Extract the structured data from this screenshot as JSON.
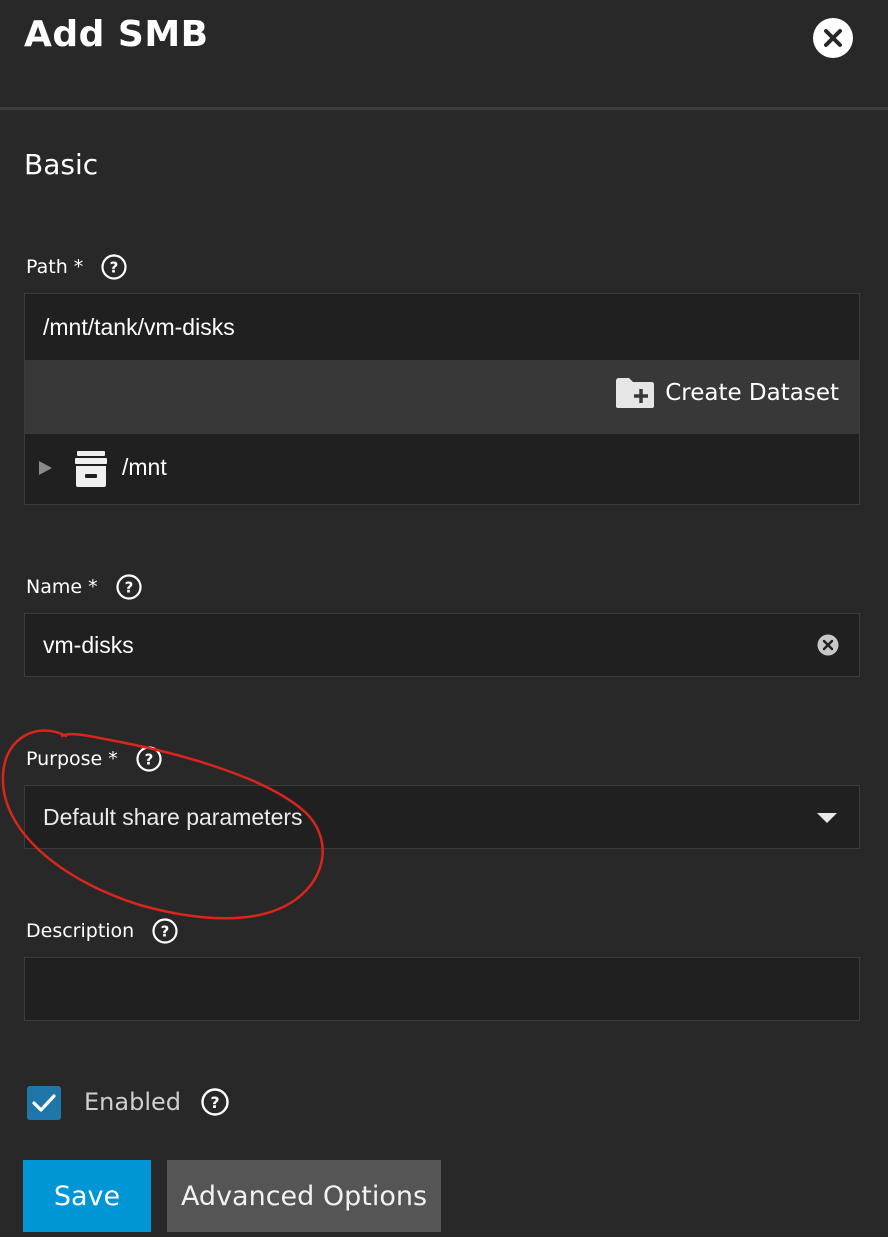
{
  "dialog": {
    "title": "Add SMB",
    "close_icon": "close-icon"
  },
  "section": {
    "title": "Basic"
  },
  "path": {
    "label": "Path",
    "required": "*",
    "value": "/mnt/tank/vm-disks",
    "create_dataset_label": "Create Dataset",
    "tree": [
      {
        "label": "/mnt",
        "icon": "storage-icon",
        "expanded": false
      }
    ]
  },
  "name": {
    "label": "Name",
    "required": "*",
    "value": "vm-disks"
  },
  "purpose": {
    "label": "Purpose",
    "required": "*",
    "value": "Default share parameters"
  },
  "description": {
    "label": "Description",
    "value": ""
  },
  "enabled": {
    "label": "Enabled",
    "checked": true
  },
  "buttons": {
    "save": "Save",
    "advanced": "Advanced Options"
  },
  "colors": {
    "background": "#282828",
    "primary": "#0095d5",
    "checkbox": "#1f76a8",
    "annotation": "#d9261c"
  }
}
